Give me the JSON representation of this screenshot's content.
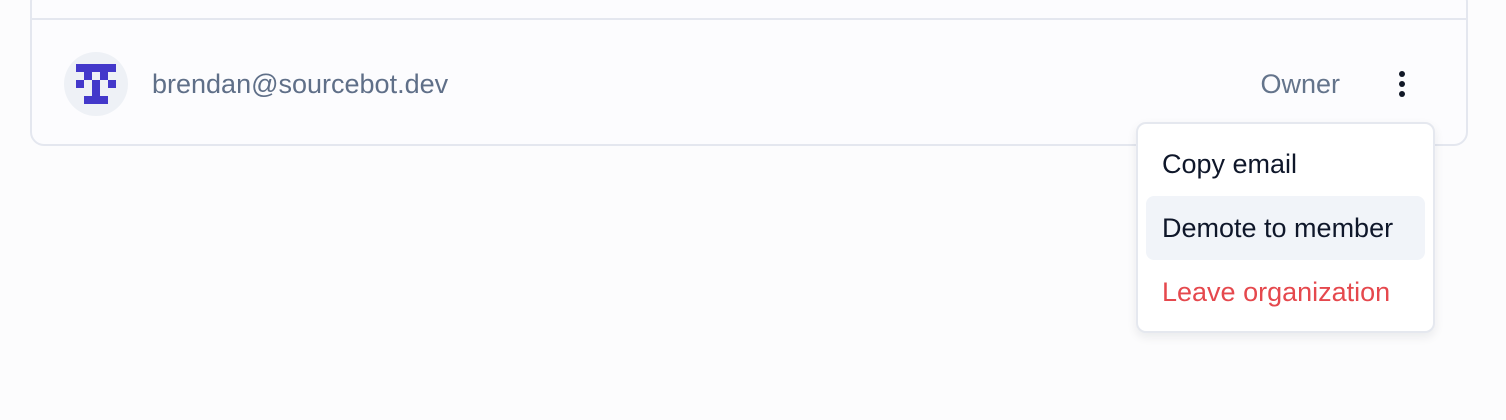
{
  "member": {
    "email": "brendan@sourcebot.dev",
    "role": "Owner",
    "avatar_icon": "identicon-avatar",
    "avatar_color": "#4338ca",
    "actions_icon": "more-vertical-icon"
  },
  "menu": {
    "items": [
      {
        "label": "Copy email"
      },
      {
        "label": "Demote to member"
      },
      {
        "label": "Leave organization"
      }
    ],
    "danger_color": "#e5484d",
    "highlight_color": "#f1f4f9"
  }
}
